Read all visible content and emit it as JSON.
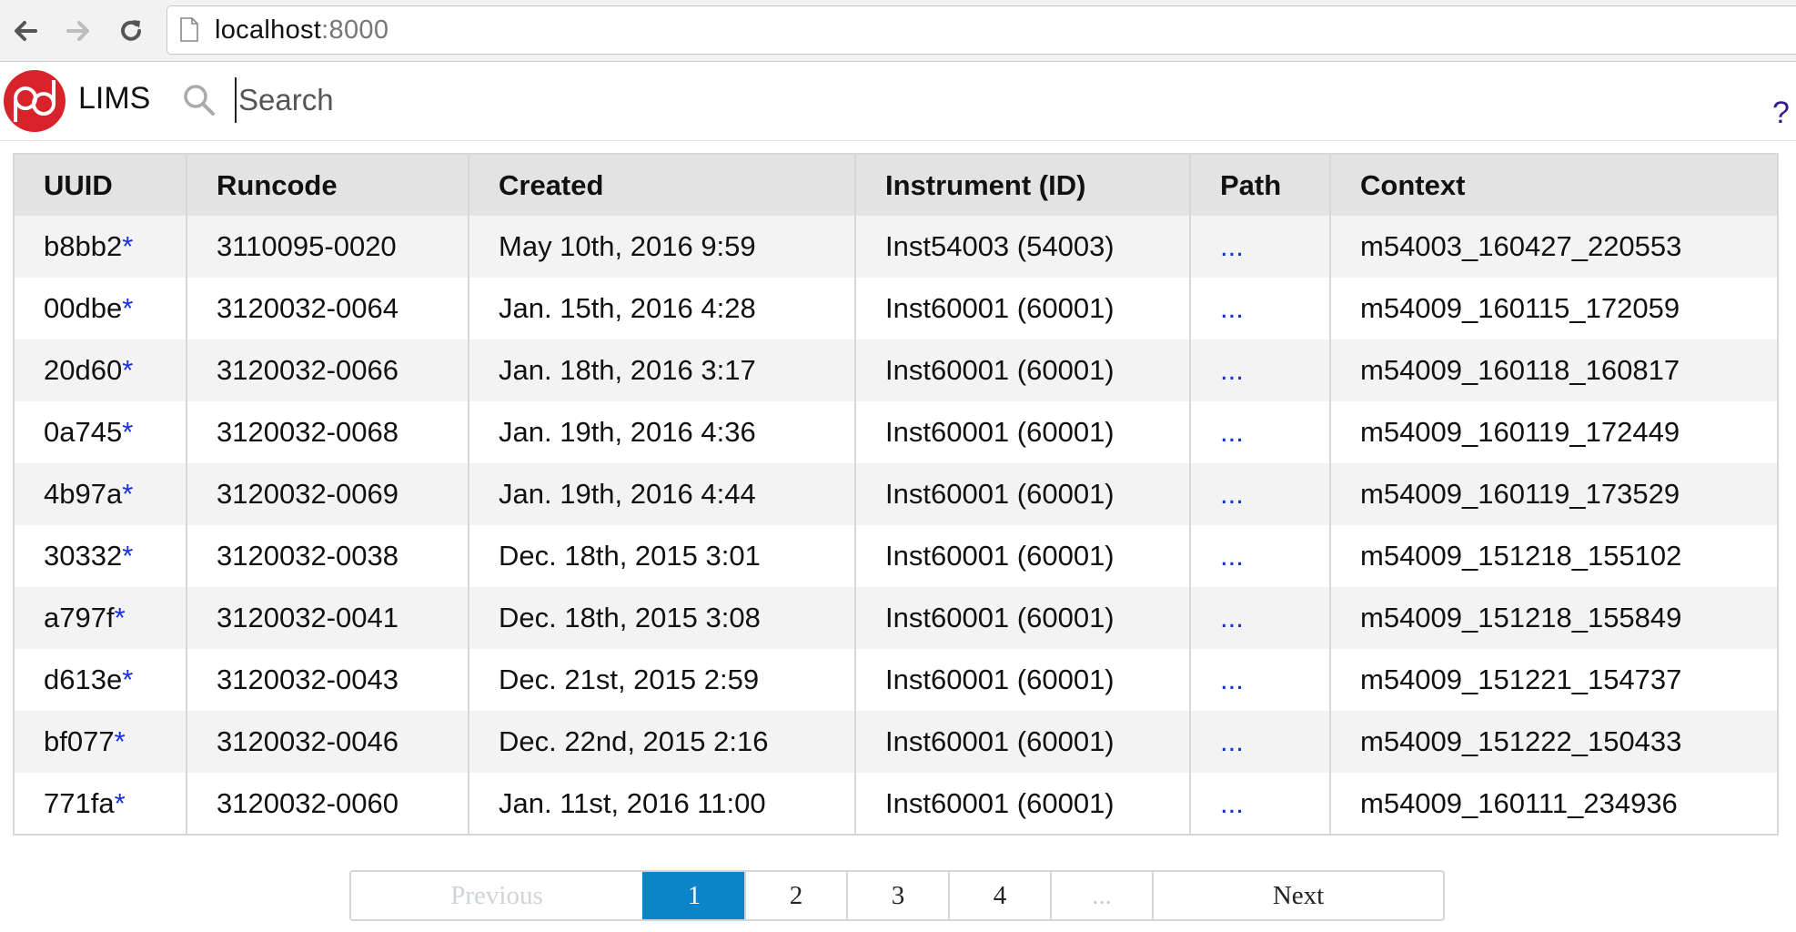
{
  "browser": {
    "url_host": "localhost",
    "url_port": ":8000"
  },
  "header": {
    "app_name": "LIMS",
    "search_placeholder": "Search",
    "help_label": "?"
  },
  "table": {
    "columns": [
      "UUID",
      "Runcode",
      "Created",
      "Instrument (ID)",
      "Path",
      "Context"
    ],
    "rows": [
      {
        "uuid": "b8bb2",
        "runcode": "3110095-0020",
        "created": "May 10th, 2016 9:59",
        "instrument": "Inst54003 (54003)",
        "path": "...",
        "context": "m54003_160427_220553"
      },
      {
        "uuid": "00dbe",
        "runcode": "3120032-0064",
        "created": "Jan. 15th, 2016 4:28",
        "instrument": "Inst60001 (60001)",
        "path": "...",
        "context": "m54009_160115_172059"
      },
      {
        "uuid": "20d60",
        "runcode": "3120032-0066",
        "created": "Jan. 18th, 2016 3:17",
        "instrument": "Inst60001 (60001)",
        "path": "...",
        "context": "m54009_160118_160817"
      },
      {
        "uuid": "0a745",
        "runcode": "3120032-0068",
        "created": "Jan. 19th, 2016 4:36",
        "instrument": "Inst60001 (60001)",
        "path": "...",
        "context": "m54009_160119_172449"
      },
      {
        "uuid": "4b97a",
        "runcode": "3120032-0069",
        "created": "Jan. 19th, 2016 4:44",
        "instrument": "Inst60001 (60001)",
        "path": "...",
        "context": "m54009_160119_173529"
      },
      {
        "uuid": "30332",
        "runcode": "3120032-0038",
        "created": "Dec. 18th, 2015 3:01",
        "instrument": "Inst60001 (60001)",
        "path": "...",
        "context": "m54009_151218_155102"
      },
      {
        "uuid": "a797f",
        "runcode": "3120032-0041",
        "created": "Dec. 18th, 2015 3:08",
        "instrument": "Inst60001 (60001)",
        "path": "...",
        "context": "m54009_151218_155849"
      },
      {
        "uuid": "d613e",
        "runcode": "3120032-0043",
        "created": "Dec. 21st, 2015 2:59",
        "instrument": "Inst60001 (60001)",
        "path": "...",
        "context": "m54009_151221_154737"
      },
      {
        "uuid": "bf077",
        "runcode": "3120032-0046",
        "created": "Dec. 22nd, 2015 2:16",
        "instrument": "Inst60001 (60001)",
        "path": "...",
        "context": "m54009_151222_150433"
      },
      {
        "uuid": "771fa",
        "runcode": "3120032-0060",
        "created": "Jan. 11st, 2016 11:00",
        "instrument": "Inst60001 (60001)",
        "path": "...",
        "context": "m54009_160111_234936"
      }
    ],
    "uuid_marker": "*"
  },
  "pagination": {
    "previous_label": "Previous",
    "pages": [
      "1",
      "2",
      "3",
      "4"
    ],
    "active_page": "1",
    "ellipsis": "...",
    "next_label": "Next"
  },
  "colors": {
    "logo_red": "#d8232a",
    "link_blue": "#1a2fd6",
    "active_page_bg": "#0a85c9",
    "help_purple": "#3a1b8a"
  },
  "icons": {
    "back": "arrow-left-icon",
    "forward": "arrow-right-icon",
    "reload": "reload-icon",
    "page": "page-icon",
    "search": "search-icon",
    "logo": "pb-logo-icon"
  }
}
